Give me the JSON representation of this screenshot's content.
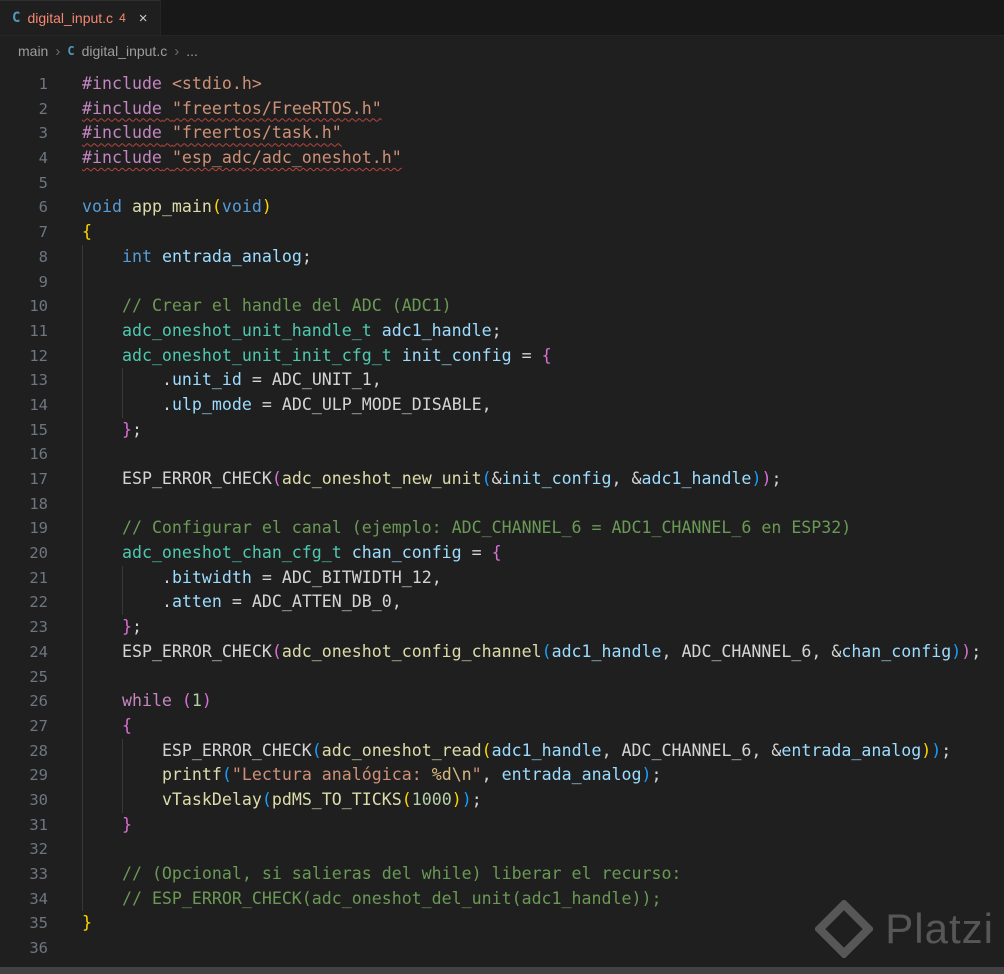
{
  "tab": {
    "icon_letter": "C",
    "title": "digital_input.c",
    "problems_badge": "4",
    "close_glyph": "×"
  },
  "breadcrumb": {
    "root": "main",
    "file_icon_letter": "C",
    "file": "digital_input.c",
    "symbol": "...",
    "separator": "›"
  },
  "watermark": {
    "text": "Platzi"
  },
  "colors": {
    "editor_background": "#1f1f1f",
    "tabbar_background": "#181818",
    "error_squiggle": "#b8453d",
    "tab_error_label": "#f48771",
    "comment_green": "#6A9955",
    "type_teal": "#4EC9B0",
    "keyword_pink": "#C586C0",
    "keyword_blue": "#569CD6",
    "string_orange": "#CE9178"
  },
  "editor": {
    "language": "c",
    "lines": [
      {
        "n": 1,
        "g": 0,
        "t": [
          [
            "#include",
            "p"
          ],
          [
            " ",
            "w"
          ],
          [
            "<stdio.h>",
            "s"
          ]
        ]
      },
      {
        "n": 2,
        "g": 0,
        "t": [
          [
            "#include",
            "p sq"
          ],
          [
            " ",
            "w sq"
          ],
          [
            "\"freertos/FreeRTOS.h\"",
            "s sq"
          ]
        ]
      },
      {
        "n": 3,
        "g": 0,
        "t": [
          [
            "#include",
            "p sq"
          ],
          [
            " ",
            "w sq"
          ],
          [
            "\"freertos/task.h\"",
            "s sq"
          ]
        ]
      },
      {
        "n": 4,
        "g": 0,
        "t": [
          [
            "#include",
            "p sq"
          ],
          [
            " ",
            "w sq"
          ],
          [
            "\"esp_adc/adc_oneshot.h\"",
            "s sq"
          ]
        ]
      },
      {
        "n": 5,
        "g": 0,
        "t": []
      },
      {
        "n": 6,
        "g": 0,
        "t": [
          [
            "void",
            "b"
          ],
          [
            " ",
            "w"
          ],
          [
            "app_main",
            "f"
          ],
          [
            "(",
            "g1"
          ],
          [
            "void",
            "b"
          ],
          [
            ")",
            "g1"
          ]
        ]
      },
      {
        "n": 7,
        "g": 0,
        "t": [
          [
            "{",
            "g1"
          ]
        ]
      },
      {
        "n": 8,
        "g": 1,
        "t": [
          [
            "    ",
            "w"
          ],
          [
            "int",
            "b"
          ],
          [
            " ",
            "w"
          ],
          [
            "entrada_analog",
            "v"
          ],
          [
            ";",
            "w"
          ]
        ]
      },
      {
        "n": 9,
        "g": 1,
        "t": []
      },
      {
        "n": 10,
        "g": 1,
        "t": [
          [
            "    ",
            "w"
          ],
          [
            "// Crear el handle del ADC (ADC1)",
            "c"
          ]
        ]
      },
      {
        "n": 11,
        "g": 1,
        "t": [
          [
            "    ",
            "w"
          ],
          [
            "adc_oneshot_unit_handle_t",
            "t"
          ],
          [
            " ",
            "w"
          ],
          [
            "adc1_handle",
            "v"
          ],
          [
            ";",
            "w"
          ]
        ]
      },
      {
        "n": 12,
        "g": 1,
        "t": [
          [
            "    ",
            "w"
          ],
          [
            "adc_oneshot_unit_init_cfg_t",
            "t"
          ],
          [
            " ",
            "w"
          ],
          [
            "init_config",
            "v"
          ],
          [
            " = ",
            "w"
          ],
          [
            "{",
            "g2"
          ]
        ]
      },
      {
        "n": 13,
        "g": 2,
        "t": [
          [
            "        ",
            "w"
          ],
          [
            ".",
            "w"
          ],
          [
            "unit_id",
            "v"
          ],
          [
            " = ",
            "w"
          ],
          [
            "ADC_UNIT_1",
            "w"
          ],
          [
            ",",
            "w"
          ]
        ]
      },
      {
        "n": 14,
        "g": 2,
        "t": [
          [
            "        ",
            "w"
          ],
          [
            ".",
            "w"
          ],
          [
            "ulp_mode",
            "v"
          ],
          [
            " = ",
            "w"
          ],
          [
            "ADC_ULP_MODE_DISABLE",
            "w"
          ],
          [
            ",",
            "w"
          ]
        ]
      },
      {
        "n": 15,
        "g": 1,
        "t": [
          [
            "    ",
            "w"
          ],
          [
            "}",
            "g2"
          ],
          [
            ";",
            "w"
          ]
        ]
      },
      {
        "n": 16,
        "g": 1,
        "t": []
      },
      {
        "n": 17,
        "g": 1,
        "t": [
          [
            "    ",
            "w"
          ],
          [
            "ESP_ERROR_CHECK",
            "w"
          ],
          [
            "(",
            "g2"
          ],
          [
            "adc_oneshot_new_unit",
            "f"
          ],
          [
            "(",
            "g3"
          ],
          [
            "&",
            "w"
          ],
          [
            "init_config",
            "v"
          ],
          [
            ", ",
            "w"
          ],
          [
            "&",
            "w"
          ],
          [
            "adc1_handle",
            "v"
          ],
          [
            ")",
            "g3"
          ],
          [
            ")",
            "g2"
          ],
          [
            ";",
            "w"
          ]
        ]
      },
      {
        "n": 18,
        "g": 1,
        "t": []
      },
      {
        "n": 19,
        "g": 1,
        "t": [
          [
            "    ",
            "w"
          ],
          [
            "// Configurar el canal (ejemplo: ADC_CHANNEL_6 = ADC1_CHANNEL_6 en ESP32)",
            "c"
          ]
        ]
      },
      {
        "n": 20,
        "g": 1,
        "t": [
          [
            "    ",
            "w"
          ],
          [
            "adc_oneshot_chan_cfg_t",
            "t"
          ],
          [
            " ",
            "w"
          ],
          [
            "chan_config",
            "v"
          ],
          [
            " = ",
            "w"
          ],
          [
            "{",
            "g2"
          ]
        ]
      },
      {
        "n": 21,
        "g": 2,
        "t": [
          [
            "        ",
            "w"
          ],
          [
            ".",
            "w"
          ],
          [
            "bitwidth",
            "v"
          ],
          [
            " = ",
            "w"
          ],
          [
            "ADC_BITWIDTH_12",
            "w"
          ],
          [
            ",",
            "w"
          ]
        ]
      },
      {
        "n": 22,
        "g": 2,
        "t": [
          [
            "        ",
            "w"
          ],
          [
            ".",
            "w"
          ],
          [
            "atten",
            "v"
          ],
          [
            " = ",
            "w"
          ],
          [
            "ADC_ATTEN_DB_0",
            "w"
          ],
          [
            ",",
            "w"
          ]
        ]
      },
      {
        "n": 23,
        "g": 1,
        "t": [
          [
            "    ",
            "w"
          ],
          [
            "}",
            "g2"
          ],
          [
            ";",
            "w"
          ]
        ]
      },
      {
        "n": 24,
        "g": 1,
        "t": [
          [
            "    ",
            "w"
          ],
          [
            "ESP_ERROR_CHECK",
            "w"
          ],
          [
            "(",
            "g2"
          ],
          [
            "adc_oneshot_config_channel",
            "f"
          ],
          [
            "(",
            "g3"
          ],
          [
            "adc1_handle",
            "v"
          ],
          [
            ", ",
            "w"
          ],
          [
            "ADC_CHANNEL_6",
            "w"
          ],
          [
            ", ",
            "w"
          ],
          [
            "&",
            "w"
          ],
          [
            "chan_config",
            "v"
          ],
          [
            ")",
            "g3"
          ],
          [
            ")",
            "g2"
          ],
          [
            ";",
            "w"
          ]
        ]
      },
      {
        "n": 25,
        "g": 1,
        "t": []
      },
      {
        "n": 26,
        "g": 1,
        "t": [
          [
            "    ",
            "w"
          ],
          [
            "while",
            "p"
          ],
          [
            " ",
            "w"
          ],
          [
            "(",
            "g2"
          ],
          [
            "1",
            "n"
          ],
          [
            ")",
            "g2"
          ]
        ]
      },
      {
        "n": 27,
        "g": 1,
        "t": [
          [
            "    ",
            "w"
          ],
          [
            "{",
            "g2"
          ]
        ]
      },
      {
        "n": 28,
        "g": 2,
        "t": [
          [
            "        ",
            "w"
          ],
          [
            "ESP_ERROR_CHECK",
            "w"
          ],
          [
            "(",
            "g3"
          ],
          [
            "adc_oneshot_read",
            "f"
          ],
          [
            "(",
            "g1"
          ],
          [
            "adc1_handle",
            "v"
          ],
          [
            ", ",
            "w"
          ],
          [
            "ADC_CHANNEL_6",
            "w"
          ],
          [
            ", ",
            "w"
          ],
          [
            "&",
            "w"
          ],
          [
            "entrada_analog",
            "v"
          ],
          [
            ")",
            "g1"
          ],
          [
            ")",
            "g3"
          ],
          [
            ";",
            "w"
          ]
        ]
      },
      {
        "n": 29,
        "g": 2,
        "t": [
          [
            "        ",
            "w"
          ],
          [
            "printf",
            "f"
          ],
          [
            "(",
            "g3"
          ],
          [
            "\"Lectura analógica: ",
            "s"
          ],
          [
            "%d",
            "e"
          ],
          [
            "\\n",
            "e"
          ],
          [
            "\"",
            "s"
          ],
          [
            ", ",
            "w"
          ],
          [
            "entrada_analog",
            "v"
          ],
          [
            ")",
            "g3"
          ],
          [
            ";",
            "w"
          ]
        ]
      },
      {
        "n": 30,
        "g": 2,
        "t": [
          [
            "        ",
            "w"
          ],
          [
            "vTaskDelay",
            "f"
          ],
          [
            "(",
            "g3"
          ],
          [
            "pdMS_TO_TICKS",
            "f"
          ],
          [
            "(",
            "g1"
          ],
          [
            "1000",
            "n"
          ],
          [
            ")",
            "g1"
          ],
          [
            ")",
            "g3"
          ],
          [
            ";",
            "w"
          ]
        ]
      },
      {
        "n": 31,
        "g": 1,
        "t": [
          [
            "    ",
            "w"
          ],
          [
            "}",
            "g2"
          ]
        ]
      },
      {
        "n": 32,
        "g": 1,
        "t": []
      },
      {
        "n": 33,
        "g": 1,
        "t": [
          [
            "    ",
            "w"
          ],
          [
            "// (Opcional, si salieras del while) liberar el recurso:",
            "c"
          ]
        ]
      },
      {
        "n": 34,
        "g": 1,
        "t": [
          [
            "    ",
            "w"
          ],
          [
            "// ESP_ERROR_CHECK(adc_oneshot_del_unit(adc1_handle));",
            "c"
          ]
        ]
      },
      {
        "n": 35,
        "g": 0,
        "t": [
          [
            "}",
            "g1"
          ]
        ]
      },
      {
        "n": 36,
        "g": 0,
        "t": []
      }
    ]
  }
}
